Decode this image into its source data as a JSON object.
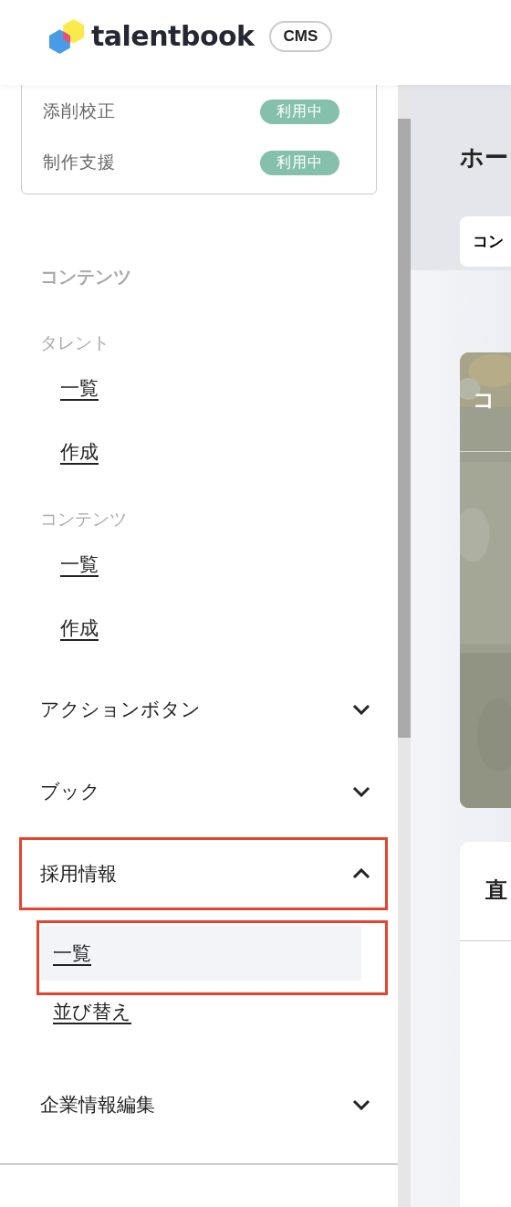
{
  "header": {
    "logo": "talentbook",
    "badge": "CMS"
  },
  "plan": {
    "options": [
      {
        "name": "添削校正",
        "status": "利用中"
      },
      {
        "name": "制作支援",
        "status": "利用中"
      }
    ]
  },
  "nav": [
    {
      "kind": "section",
      "label": "コンテンツ"
    },
    {
      "kind": "group",
      "label": "タレント"
    },
    {
      "kind": "link",
      "label": "一覧"
    },
    {
      "kind": "link",
      "label": "作成"
    },
    {
      "kind": "group",
      "label": "コンテンツ"
    },
    {
      "kind": "link",
      "label": "一覧"
    },
    {
      "kind": "link",
      "label": "作成"
    },
    {
      "kind": "accordion",
      "label": "アクションボタン",
      "expanded": false,
      "highlighted": false
    },
    {
      "kind": "accordion",
      "label": "ブック",
      "expanded": false,
      "highlighted": false
    },
    {
      "kind": "accordion",
      "label": "採用情報",
      "expanded": true,
      "highlighted": true,
      "children": [
        {
          "label": "一覧",
          "selected": true,
          "highlighted": true
        },
        {
          "label": "並び替え",
          "selected": false,
          "highlighted": false
        }
      ]
    },
    {
      "kind": "accordion",
      "label": "企業情報編集",
      "expanded": false,
      "highlighted": false
    }
  ],
  "main": {
    "title": "ホー",
    "tab": "コン",
    "hero_title": "コ",
    "card_title": "直"
  }
}
